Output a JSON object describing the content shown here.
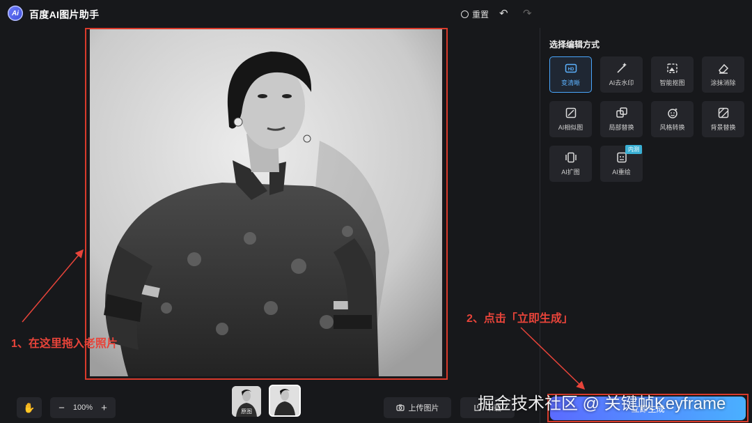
{
  "app": {
    "title": "百度AI图片助手",
    "logo_text": "Ai"
  },
  "toolbar": {
    "reset_label": "重置",
    "undo_icon": "undo-icon",
    "redo_icon": "redo-icon"
  },
  "panel": {
    "title": "选择编辑方式",
    "tools": [
      {
        "label": "变清晰",
        "icon": "hd-icon",
        "active": true
      },
      {
        "label": "AI去水印",
        "icon": "magic-wand-icon"
      },
      {
        "label": "智能抠图",
        "icon": "cutout-icon"
      },
      {
        "label": "涂抹消除",
        "icon": "eraser-icon"
      },
      {
        "label": "AI相似图",
        "icon": "similar-image-icon"
      },
      {
        "label": "局部替换",
        "icon": "local-replace-icon"
      },
      {
        "label": "风格转换",
        "icon": "style-transfer-icon"
      },
      {
        "label": "背景替换",
        "icon": "background-replace-icon"
      },
      {
        "label": "AI扩图",
        "icon": "expand-icon"
      },
      {
        "label": "AI重绘",
        "icon": "redraw-icon",
        "badge": "内测"
      }
    ],
    "generate_label": "立即生成"
  },
  "bottom": {
    "zoom": "100%",
    "thumbs": [
      {
        "label": "原图"
      },
      {
        "label": ""
      }
    ],
    "upload_label": "上传图片",
    "download_label": "下载"
  },
  "annotations": {
    "step1": "1、在这里拖入老照片",
    "step2": "2、点击「立即生成」"
  },
  "watermark": "掘金技术社区 @ 关键帧Keyframe",
  "colors": {
    "accent": "#4aa8ff",
    "annotation": "#e8443a",
    "background": "#17181b"
  }
}
